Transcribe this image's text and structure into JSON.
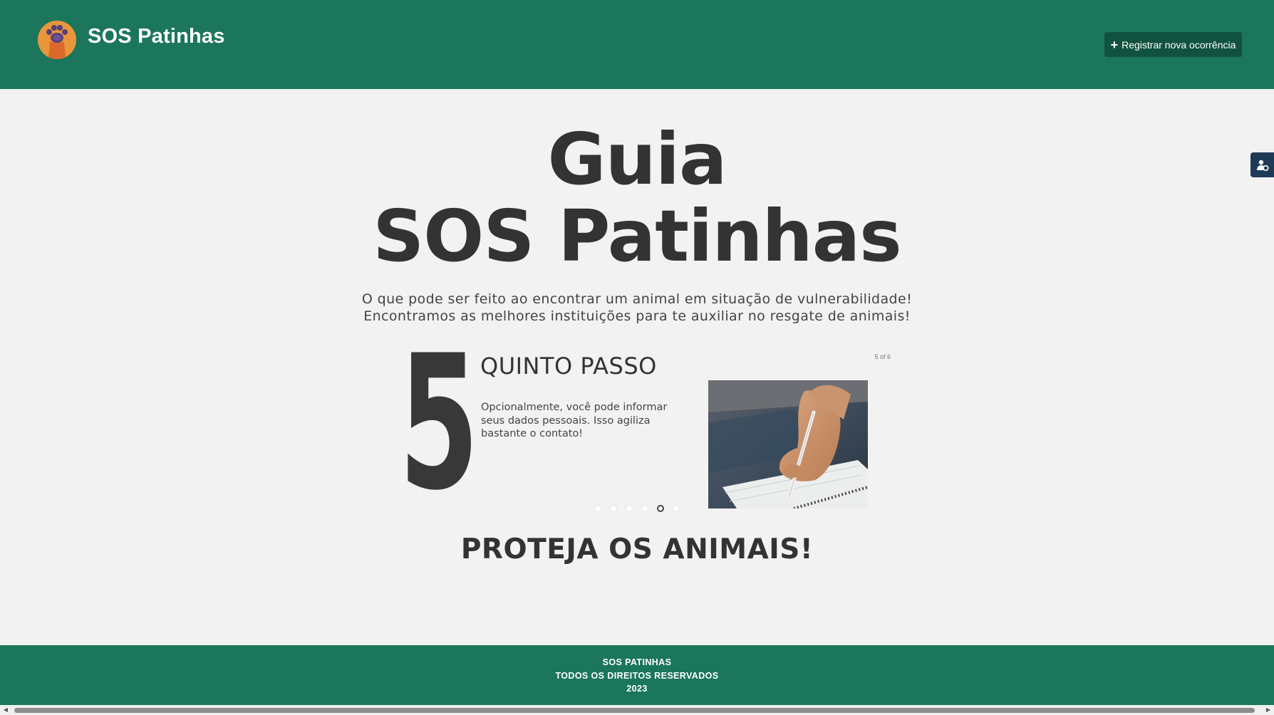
{
  "header": {
    "brand": "SOS Patinhas",
    "register_button": "Registrar nova ocorrência",
    "logo_icon": "paw-icon"
  },
  "hero": {
    "title_line1": "Guia",
    "title_line2": "SOS Patinhas",
    "subtitle_line1": "O que pode ser feito ao encontrar um animal em situação de vulnerabilidade!",
    "subtitle_line2": "Encontramos as melhores instituições para te auxiliar no resgate de animais!"
  },
  "carousel": {
    "number": "5",
    "title": "QUINTO PASSO",
    "text": "Opcionalmente, você pode informar seus dados pessoais. Isso agiliza bastante o contato!",
    "counter": "5 of 6",
    "total_slides": 6,
    "active_slide": 5
  },
  "cta": "PROTEJA OS ANIMAIS!",
  "footer": {
    "line1": "SOS PATINHAS",
    "line2": "TODOS OS DIREITOS RESERVADOS",
    "line3": "2023"
  },
  "colors": {
    "header_bg": "#1b765b",
    "button_bg": "#11523f",
    "page_bg": "#f2f2f2",
    "text": "#333333"
  }
}
